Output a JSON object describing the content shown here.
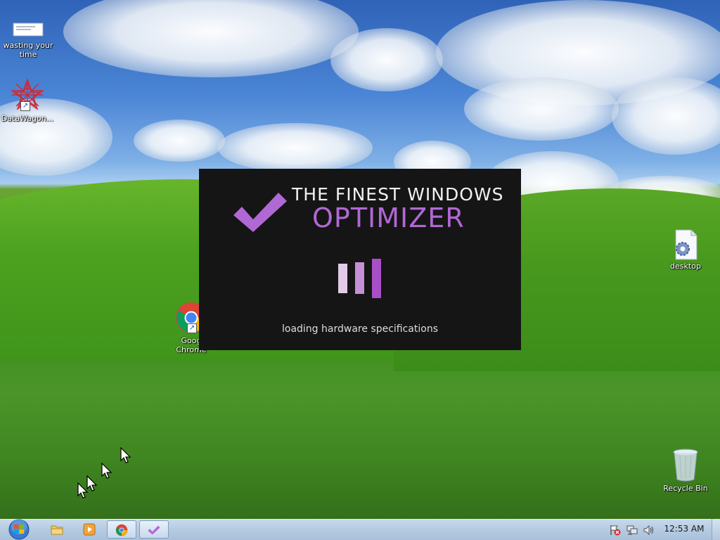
{
  "desktop": {
    "icons": [
      {
        "label": "wasting your time",
        "name": "wasting-your-time",
        "icon": "document-icon",
        "shortcut": false
      },
      {
        "label": "DataWagon...",
        "name": "datawagon",
        "icon": "datawagon-star-icon",
        "shortcut": true
      },
      {
        "label": "Goog\nChrome",
        "name": "google-chrome",
        "icon": "chrome-icon",
        "shortcut": true
      },
      {
        "label": "desktop",
        "name": "desktop-file",
        "icon": "config-file-icon",
        "shortcut": false
      },
      {
        "label": "Recycle Bin",
        "name": "recycle-bin",
        "icon": "recycle-bin-icon",
        "shortcut": false
      }
    ],
    "doc_thumbnail_text": "lorem ipsum dolor sit amet"
  },
  "splash": {
    "title_line1": "THE FINEST WINDOWS",
    "title_line2": "OPTIMIZER",
    "status": "loading hardware specifications",
    "accent_color": "#b068d4",
    "background_color": "#151515",
    "logo_icon": "checkmark-icon"
  },
  "taskbar": {
    "start_icon": "windows-start-orb-icon",
    "pinned": [
      {
        "name": "explorer",
        "icon": "folder-icon",
        "active": false
      },
      {
        "name": "media-player",
        "icon": "media-player-icon",
        "active": false
      },
      {
        "name": "chrome",
        "icon": "chrome-icon",
        "active": true
      },
      {
        "name": "optimizer",
        "icon": "checkmark-icon",
        "active": true
      }
    ],
    "tray": [
      "action-center-flag-icon",
      "network-icon",
      "volume-icon"
    ],
    "clock": "12:53 AM"
  }
}
